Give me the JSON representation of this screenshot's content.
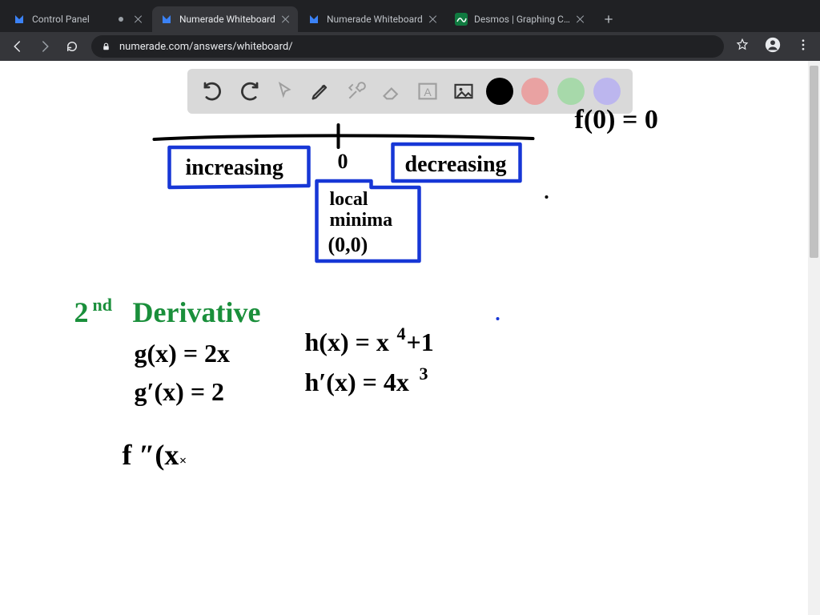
{
  "browser": {
    "tabs": [
      {
        "title": "Control Panel",
        "active": false,
        "modified": true,
        "favicon": "numerade"
      },
      {
        "title": "Numerade Whiteboard",
        "active": true,
        "modified": false,
        "favicon": "numerade"
      },
      {
        "title": "Numerade Whiteboard",
        "active": false,
        "modified": false,
        "favicon": "numerade"
      },
      {
        "title": "Desmos | Graphing Calculator",
        "active": false,
        "modified": false,
        "favicon": "desmos"
      }
    ],
    "url": "numerade.com/answers/whiteboard/"
  },
  "toolbar": {
    "tools": [
      "undo",
      "redo",
      "pointer",
      "pencil",
      "tools",
      "eraser",
      "text",
      "image"
    ],
    "swatches": [
      "black",
      "red",
      "green",
      "purple"
    ]
  },
  "board": {
    "topRightEq": "f(0) = 0",
    "numberLine": {
      "centerLabel": "0",
      "leftBox": "increasing",
      "rightBox": "decreasing",
      "bottomBox1": "local",
      "bottomBox2": "minima",
      "bottomBox3": "(0,0)"
    },
    "heading": "2",
    "headingSup": "nd",
    "headingRest": "Derivative",
    "eqs": {
      "g": "g(x) = 2x",
      "gp": "g′(x) = 2",
      "h1": "h(x) = x",
      "h1sup": "4",
      "h1rest": "+1",
      "h2": "h′(x) = 4x",
      "h2sup": "3",
      "f": "f ″(x"
    }
  }
}
